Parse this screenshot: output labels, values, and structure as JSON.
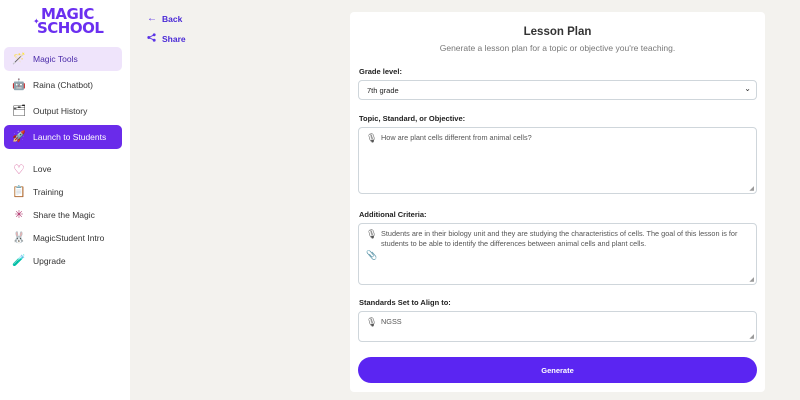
{
  "logo": {
    "line1": "MAGIC",
    "line2": "SCHOOL"
  },
  "sidebar": {
    "items": [
      {
        "label": "Magic Tools",
        "icon": "magic-tools-icon",
        "glyph": "🪄"
      },
      {
        "label": "Raina (Chatbot)",
        "icon": "robot-icon",
        "glyph": "🤖"
      },
      {
        "label": "Output History",
        "icon": "history-icon",
        "glyph": "🗂"
      },
      {
        "label": "Launch to Students",
        "icon": "rocket-icon",
        "glyph": "🚀"
      },
      {
        "label": "Love",
        "icon": "heart-icon",
        "glyph": "♡"
      },
      {
        "label": "Training",
        "icon": "easel-icon",
        "glyph": "📋"
      },
      {
        "label": "Share the Magic",
        "icon": "share-magic-icon",
        "glyph": "✳"
      },
      {
        "label": "MagicStudent Intro",
        "icon": "bunny-icon",
        "glyph": "🐰"
      },
      {
        "label": "Upgrade",
        "icon": "potion-icon",
        "glyph": "🧪"
      }
    ]
  },
  "nav": {
    "back_label": "Back",
    "share_label": "Share"
  },
  "form": {
    "title": "Lesson Plan",
    "subtitle": "Generate a lesson plan for a topic or objective you're teaching.",
    "grade": {
      "label": "Grade level:",
      "value": "7th grade"
    },
    "topic": {
      "label": "Topic, Standard, or Objective:",
      "value": "How are plant cells different from animal cells?"
    },
    "criteria": {
      "label": "Additional Criteria:",
      "value": "Students are in their biology unit and they are studying the characteristics of cells. The goal of this lesson is for students to be able to identify the differences between animal cells and plant cells."
    },
    "standards": {
      "label": "Standards Set to Align to:",
      "value": "NGSS"
    },
    "generate_label": "Generate"
  },
  "colors": {
    "accent": "#5b25f2",
    "active_light": "#efe4fb",
    "active_dark": "#6a2bea",
    "background": "#f3f2ee"
  }
}
